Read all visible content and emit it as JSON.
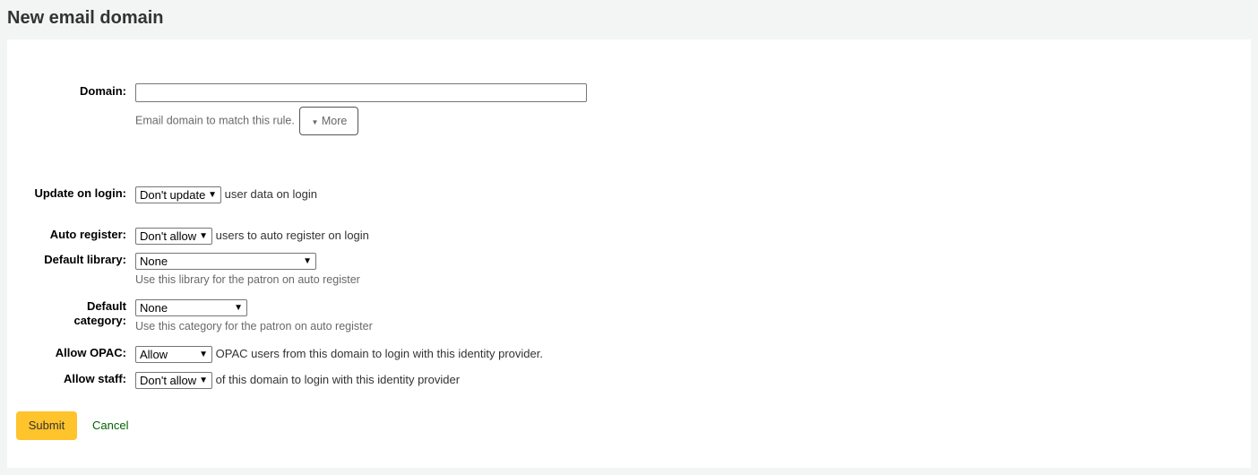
{
  "page_title": "New email domain",
  "form": {
    "domain": {
      "label": "Domain:",
      "value": "",
      "hint": "Email domain to match this rule.",
      "more_label": "More"
    },
    "update_on_login": {
      "label": "Update on login:",
      "selected": "Don't update",
      "suffix": "user data on login"
    },
    "auto_register": {
      "label": "Auto register:",
      "selected": "Don't allow",
      "suffix": "users to auto register on login"
    },
    "default_library": {
      "label": "Default library:",
      "selected": "None",
      "hint": "Use this library for the patron on auto register"
    },
    "default_category": {
      "label": "Default category:",
      "selected": "None",
      "hint": "Use this category for the patron on auto register"
    },
    "allow_opac": {
      "label": "Allow OPAC:",
      "selected": "Allow",
      "suffix": "OPAC users from this domain to login with this identity provider."
    },
    "allow_staff": {
      "label": "Allow staff:",
      "selected": "Don't allow",
      "suffix": "of this domain to login with this identity provider"
    }
  },
  "actions": {
    "submit": "Submit",
    "cancel": "Cancel"
  },
  "colors": {
    "submit_bg": "#ffc32b",
    "cancel_link": "#006100"
  }
}
